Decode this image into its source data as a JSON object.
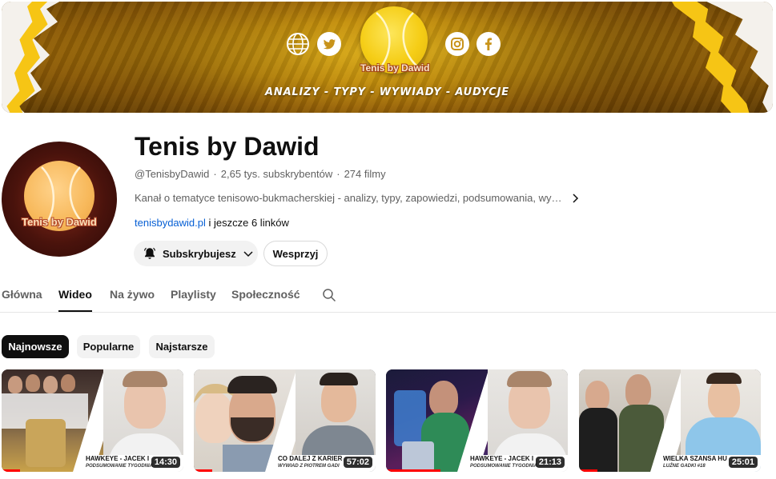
{
  "banner": {
    "logo_text": "Tenis by Dawid",
    "tagline": "ANALIZY - TYPY - WYWIADY - AUDYCJE",
    "icons": [
      "globe-icon",
      "twitter-icon",
      "instagram-icon",
      "facebook-icon"
    ]
  },
  "channel": {
    "avatar_text": "Tenis by Dawid",
    "name": "Tenis by Dawid",
    "handle": "@TenisbyDawid",
    "subscribers": "2,65 tys. subskrybentów",
    "videos": "274 filmy",
    "description": "Kanał o tematyce tenisowo-bukmacherskiej - analizy, typy, zapowiedzi, podsumowania, wy…",
    "link": "tenisbydawid.pl",
    "more_links": " i jeszcze 6 linków",
    "subscribe_label": "Subskrybujesz",
    "support_label": "Wesprzyj"
  },
  "tabs": [
    {
      "label": "Główna"
    },
    {
      "label": "Wideo"
    },
    {
      "label": "Na żywo"
    },
    {
      "label": "Playlisty"
    },
    {
      "label": "Społeczność"
    }
  ],
  "active_tab": "Wideo",
  "chips": [
    {
      "label": "Najnowsze"
    },
    {
      "label": "Popularne"
    },
    {
      "label": "Najstarsze"
    }
  ],
  "active_chip": "Najnowsze",
  "videos": [
    {
      "caption": "HAWKEYE - JACEK I",
      "subcaption": "PODSUMOWANIE TYGODNIA",
      "duration": "14:30",
      "progress": 0.1
    },
    {
      "caption": "CO DALEJ Z KARIER",
      "subcaption": "WYWIAD Z PIOTREM GADI",
      "duration": "57:02",
      "progress": 0.1
    },
    {
      "caption": "HAWKEYE - JACEK I",
      "subcaption": "PODSUMOWANIE TYGODNIA",
      "duration": "21:13",
      "progress": 0.3
    },
    {
      "caption": "WIELKA SZANSA HU",
      "subcaption": "LUŹNE GADKI #18",
      "duration": "25:01",
      "progress": 0.1
    }
  ],
  "colors": {
    "accent_link": "#065fd4",
    "banner_gold": "#f6c515",
    "progress_red": "#ff0000"
  }
}
